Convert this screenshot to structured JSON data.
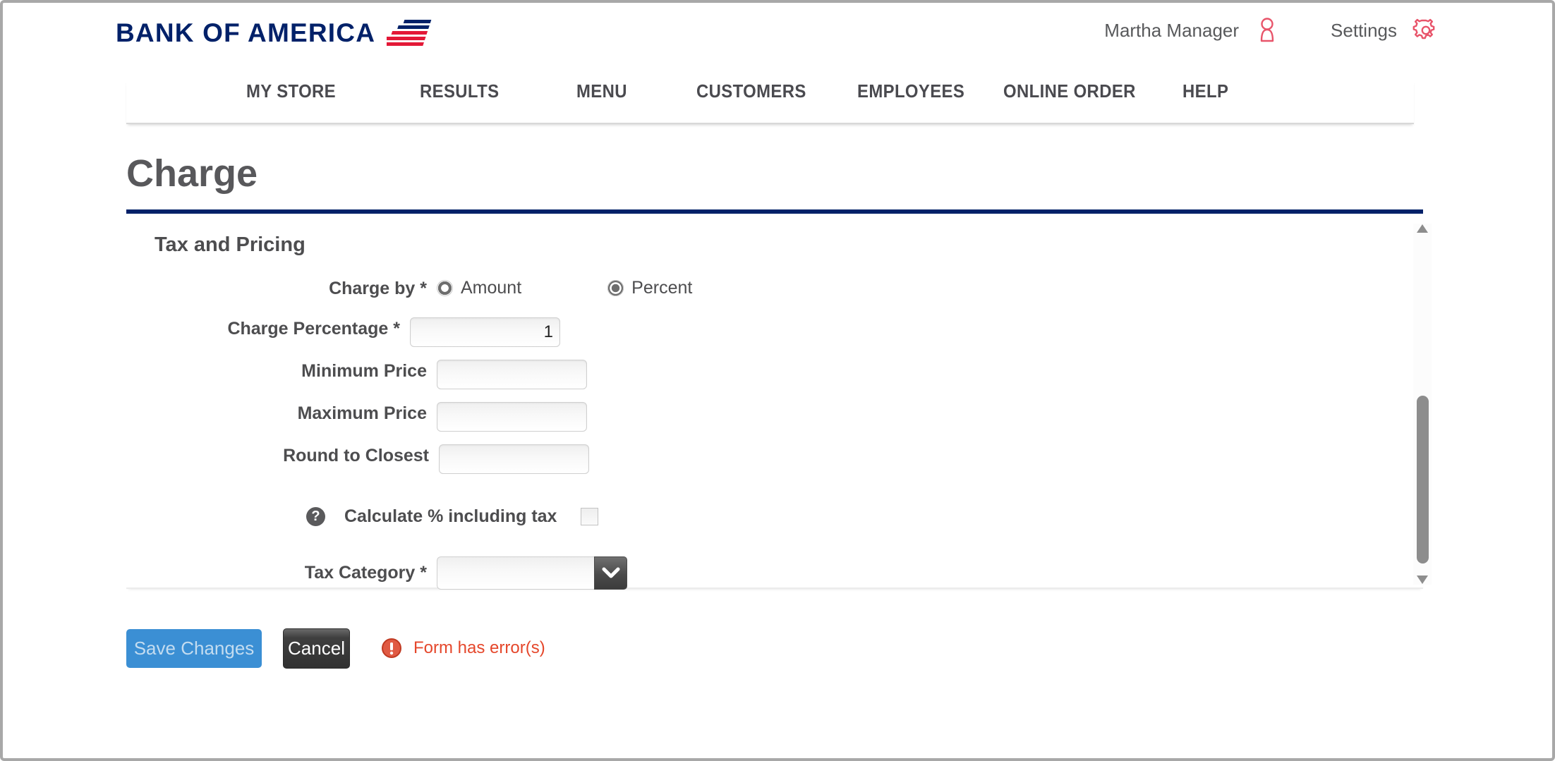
{
  "brand": {
    "name": "BANK OF AMERICA",
    "logo_navy": "#012169",
    "logo_red": "#e31837"
  },
  "header": {
    "user_name": "Martha Manager",
    "user_icon": "person-icon",
    "settings_label": "Settings",
    "settings_icon": "gear-icon",
    "icon_color": "#e8546a"
  },
  "nav": {
    "items": [
      {
        "label": "MY STORE"
      },
      {
        "label": "RESULTS"
      },
      {
        "label": "MENU"
      },
      {
        "label": "CUSTOMERS"
      },
      {
        "label": "EMPLOYEES"
      },
      {
        "label": "ONLINE ORDER"
      },
      {
        "label": "HELP"
      }
    ]
  },
  "page": {
    "title": "Charge",
    "rule_color": "#012169"
  },
  "form": {
    "section_title": "Tax and Pricing",
    "charge_by": {
      "label": "Charge by *",
      "options": [
        {
          "label": "Amount",
          "selected": false
        },
        {
          "label": "Percent",
          "selected": true
        }
      ]
    },
    "fields": [
      {
        "label": "Charge Percentage *",
        "value": "1",
        "placeholder": ""
      },
      {
        "label": "Minimum Price",
        "value": "",
        "placeholder": ""
      },
      {
        "label": "Maximum Price",
        "value": "",
        "placeholder": ""
      },
      {
        "label": "Round to Closest",
        "value": "",
        "placeholder": ""
      }
    ],
    "calculate_tax": {
      "help_icon": "question-mark-icon",
      "help_glyph": "?",
      "label": "Calculate % including tax",
      "checked": false
    },
    "tax_category": {
      "label": "Tax Category *",
      "value": "",
      "placeholder": "",
      "arrow_icon": "chevron-down-icon"
    }
  },
  "scrollbar": {
    "up_icon": "triangle-up-icon",
    "down_icon": "triangle-down-icon",
    "thumb_color": "#8d8d8d"
  },
  "footer": {
    "save_label": "Save Changes",
    "cancel_label": "Cancel",
    "error_icon": "error-exclamation-icon",
    "error_text": "Form has error(s)",
    "error_color": "#e5472b"
  }
}
